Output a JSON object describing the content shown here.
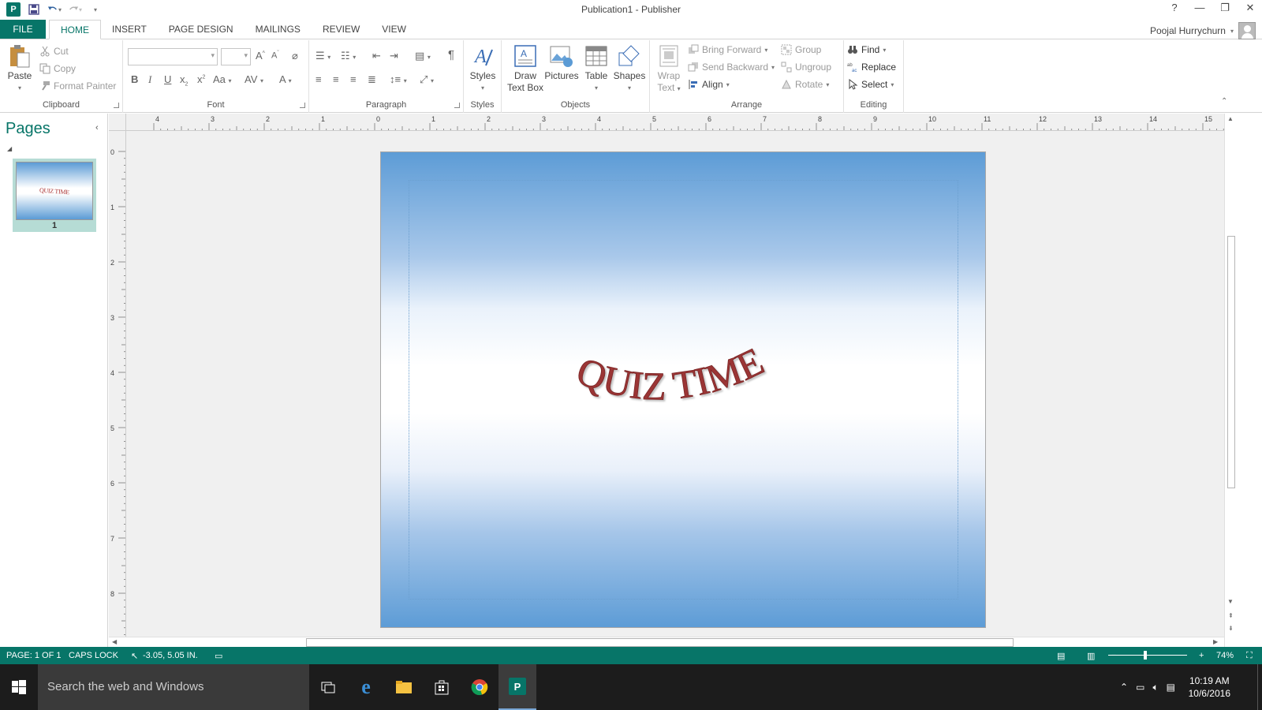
{
  "window": {
    "title": "Publication1 - Publisher",
    "controls": [
      "?",
      "—",
      "❐",
      "✕"
    ]
  },
  "tabs": [
    "FILE",
    "HOME",
    "INSERT",
    "PAGE DESIGN",
    "MAILINGS",
    "REVIEW",
    "VIEW"
  ],
  "active_tab": "HOME",
  "user": {
    "name": "Poojal Hurrychurn"
  },
  "ribbon": {
    "clipboard": {
      "label": "Clipboard",
      "paste": "Paste",
      "cut": "Cut",
      "copy": "Copy",
      "format_painter": "Format Painter"
    },
    "font": {
      "label": "Font"
    },
    "paragraph": {
      "label": "Paragraph"
    },
    "styles": {
      "label": "Styles",
      "styles_btn": "Styles"
    },
    "objects": {
      "label": "Objects",
      "draw_text_box_1": "Draw",
      "draw_text_box_2": "Text Box",
      "pictures": "Pictures",
      "table": "Table",
      "shapes": "Shapes"
    },
    "arrange": {
      "label": "Arrange",
      "wrap_text_1": "Wrap",
      "wrap_text_2": "Text",
      "bring_forward": "Bring Forward",
      "send_backward": "Send Backward",
      "align": "Align",
      "group": "Group",
      "ungroup": "Ungroup",
      "rotate": "Rotate"
    },
    "editing": {
      "label": "Editing",
      "find": "Find",
      "replace": "Replace",
      "select": "Select"
    }
  },
  "pages_pane": {
    "title": "Pages",
    "pages": [
      {
        "number": "1",
        "thumb_text": "QUIZ TIME"
      }
    ]
  },
  "rulers": {
    "horizontal": [
      "4",
      "3",
      "2",
      "1",
      "0",
      "1",
      "2",
      "3",
      "4",
      "5",
      "6",
      "7",
      "8",
      "9",
      "10",
      "11",
      "12",
      "13",
      "14",
      "15"
    ],
    "vertical": [
      "0",
      "1",
      "2",
      "3",
      "4",
      "5",
      "6",
      "7",
      "8"
    ]
  },
  "document": {
    "wordart_text": "QUIZ TIME",
    "wordart_color": "#9b3535",
    "background_top": "#5d9cd6",
    "background_mid": "#ffffff"
  },
  "status": {
    "page": "PAGE: 1 OF 1",
    "caps": "CAPS LOCK",
    "position": "-3.05, 5.05 IN.",
    "zoom": "74%"
  },
  "taskbar": {
    "search_placeholder": "Search the web and Windows",
    "time": "10:19 AM",
    "date": "10/6/2016"
  },
  "colors": {
    "accent": "#077568"
  }
}
